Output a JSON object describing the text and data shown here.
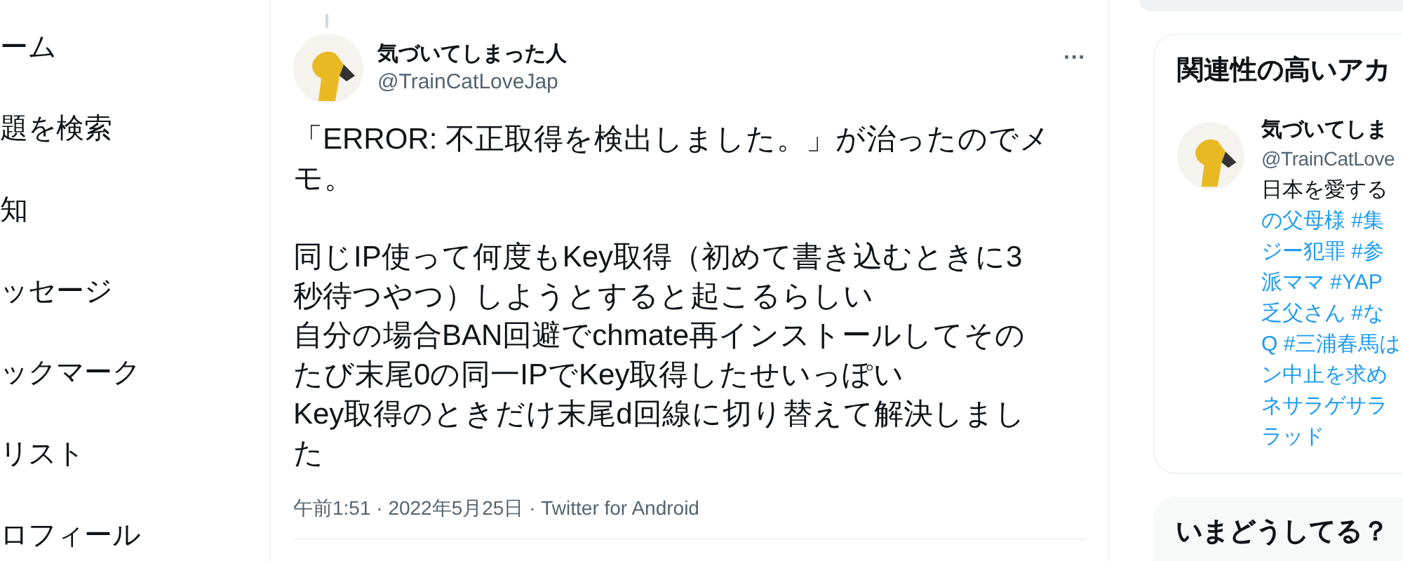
{
  "nav": {
    "items": [
      "ーム",
      "題を検索",
      "知",
      "ッセージ",
      "ックマーク",
      "リスト",
      "ロフィール"
    ]
  },
  "tweet": {
    "name": "気づいてしまった人",
    "handle": "@TrainCatLoveJap",
    "more": "···",
    "paragraphs": [
      [
        "「ERROR: 不正取得を検出しました。」が治ったのでメ",
        "モ。"
      ],
      [
        "同じIP使って何度もKey取得（初めて書き込むときに3",
        "秒待つやつ）しようとすると起こるらしい",
        "自分の場合BAN回避でchmate再インストールしてその",
        "たび末尾0の同一IPでKey取得したせいっぽい",
        "Key取得のときだけ末尾d回線に切り替えて解決しまし",
        "た"
      ]
    ],
    "meta": "午前1:51 · 2022年5月25日 · Twitter for Android"
  },
  "related": {
    "title": "関連性の高いアカ",
    "name": "気づいてしま",
    "handle": "@TrainCatLove",
    "bio_text": "日本を愛する",
    "bio_tags": [
      "の父母様 #集",
      "ジー犯罪 #参",
      "派ママ #YAP",
      "乏父さん #な",
      "Q #三浦春馬は",
      "ン中止を求め",
      "ネサラゲサラ",
      "ラッド"
    ]
  },
  "trends": {
    "title": "いまどうしてる？"
  }
}
